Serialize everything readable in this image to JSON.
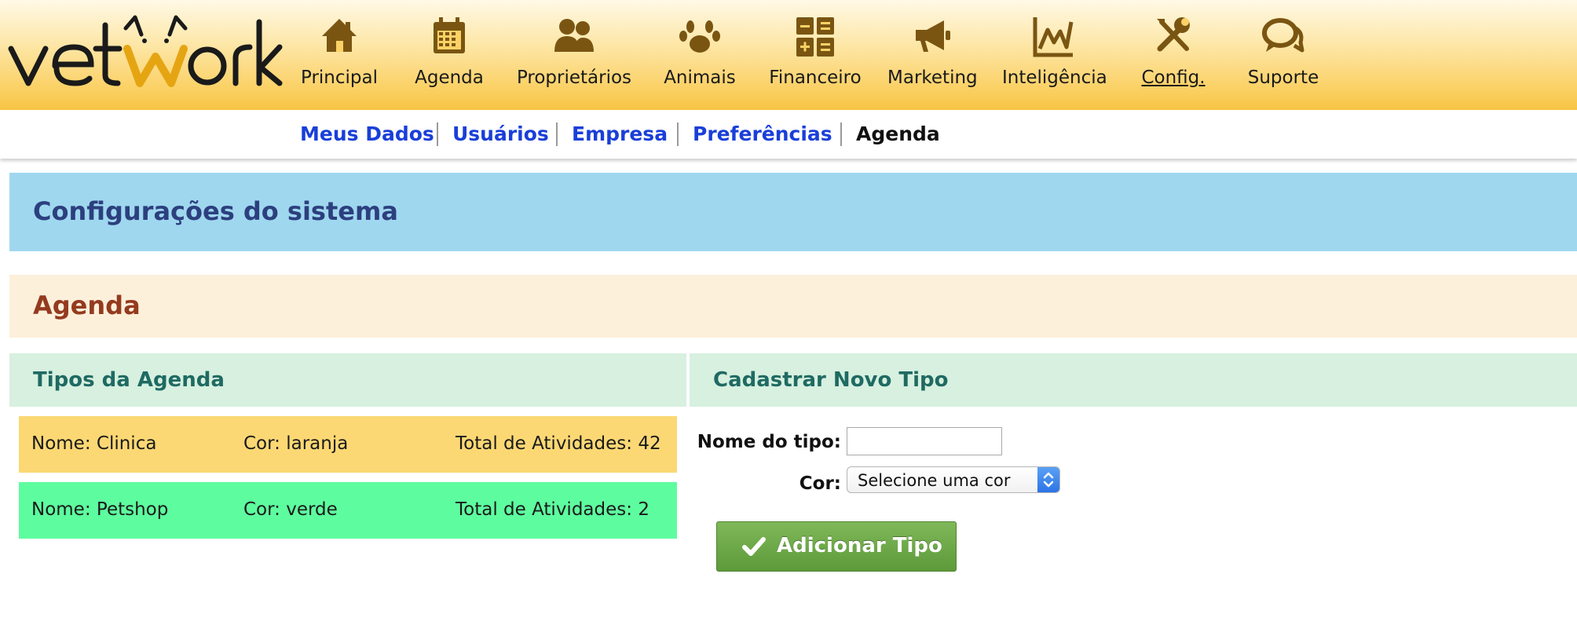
{
  "brand": {
    "logo_text": "vetwork"
  },
  "nav": {
    "items": [
      {
        "label": "Principal",
        "icon": "home-icon"
      },
      {
        "label": "Agenda",
        "icon": "calendar-icon"
      },
      {
        "label": "Proprietários",
        "icon": "users-icon"
      },
      {
        "label": "Animais",
        "icon": "paw-icon"
      },
      {
        "label": "Financeiro",
        "icon": "calculator-icon"
      },
      {
        "label": "Marketing",
        "icon": "megaphone-icon"
      },
      {
        "label": "Inteligência",
        "icon": "chart-icon"
      },
      {
        "label": "Config.",
        "icon": "tools-icon",
        "active": true
      },
      {
        "label": "Suporte",
        "icon": "chat-icon"
      }
    ]
  },
  "subnav": {
    "items": [
      {
        "label": "Meus Dados"
      },
      {
        "label": "Usuários"
      },
      {
        "label": "Empresa"
      },
      {
        "label": "Preferências"
      },
      {
        "label": "Agenda",
        "current": true
      }
    ]
  },
  "page": {
    "title": "Configurações do sistema",
    "section": "Agenda"
  },
  "types_panel": {
    "heading": "Tipos da Agenda",
    "rows": [
      {
        "name": "Nome: Clinica",
        "color": "Cor: laranja",
        "total": "Total de Atividades: 42",
        "bg": "#fcd874"
      },
      {
        "name": "Nome: Petshop",
        "color": "Cor: verde",
        "total": "Total de Atividades: 2",
        "bg": "#5dfd9f"
      }
    ]
  },
  "form_panel": {
    "heading": "Cadastrar Novo Tipo",
    "name_label": "Nome do tipo:",
    "name_value": "",
    "color_label": "Cor:",
    "color_selected": "Selecione uma cor",
    "submit_label": "Adicionar Tipo"
  },
  "colors": {
    "header_gold": "#f7c443",
    "link_blue": "#1a3fd8",
    "title_bar": "#9fd7ef",
    "section_bar": "#fcf0db",
    "panel_head": "#d7f0e0",
    "button_green": "#6aa845",
    "icon_brown": "#7a5512"
  }
}
